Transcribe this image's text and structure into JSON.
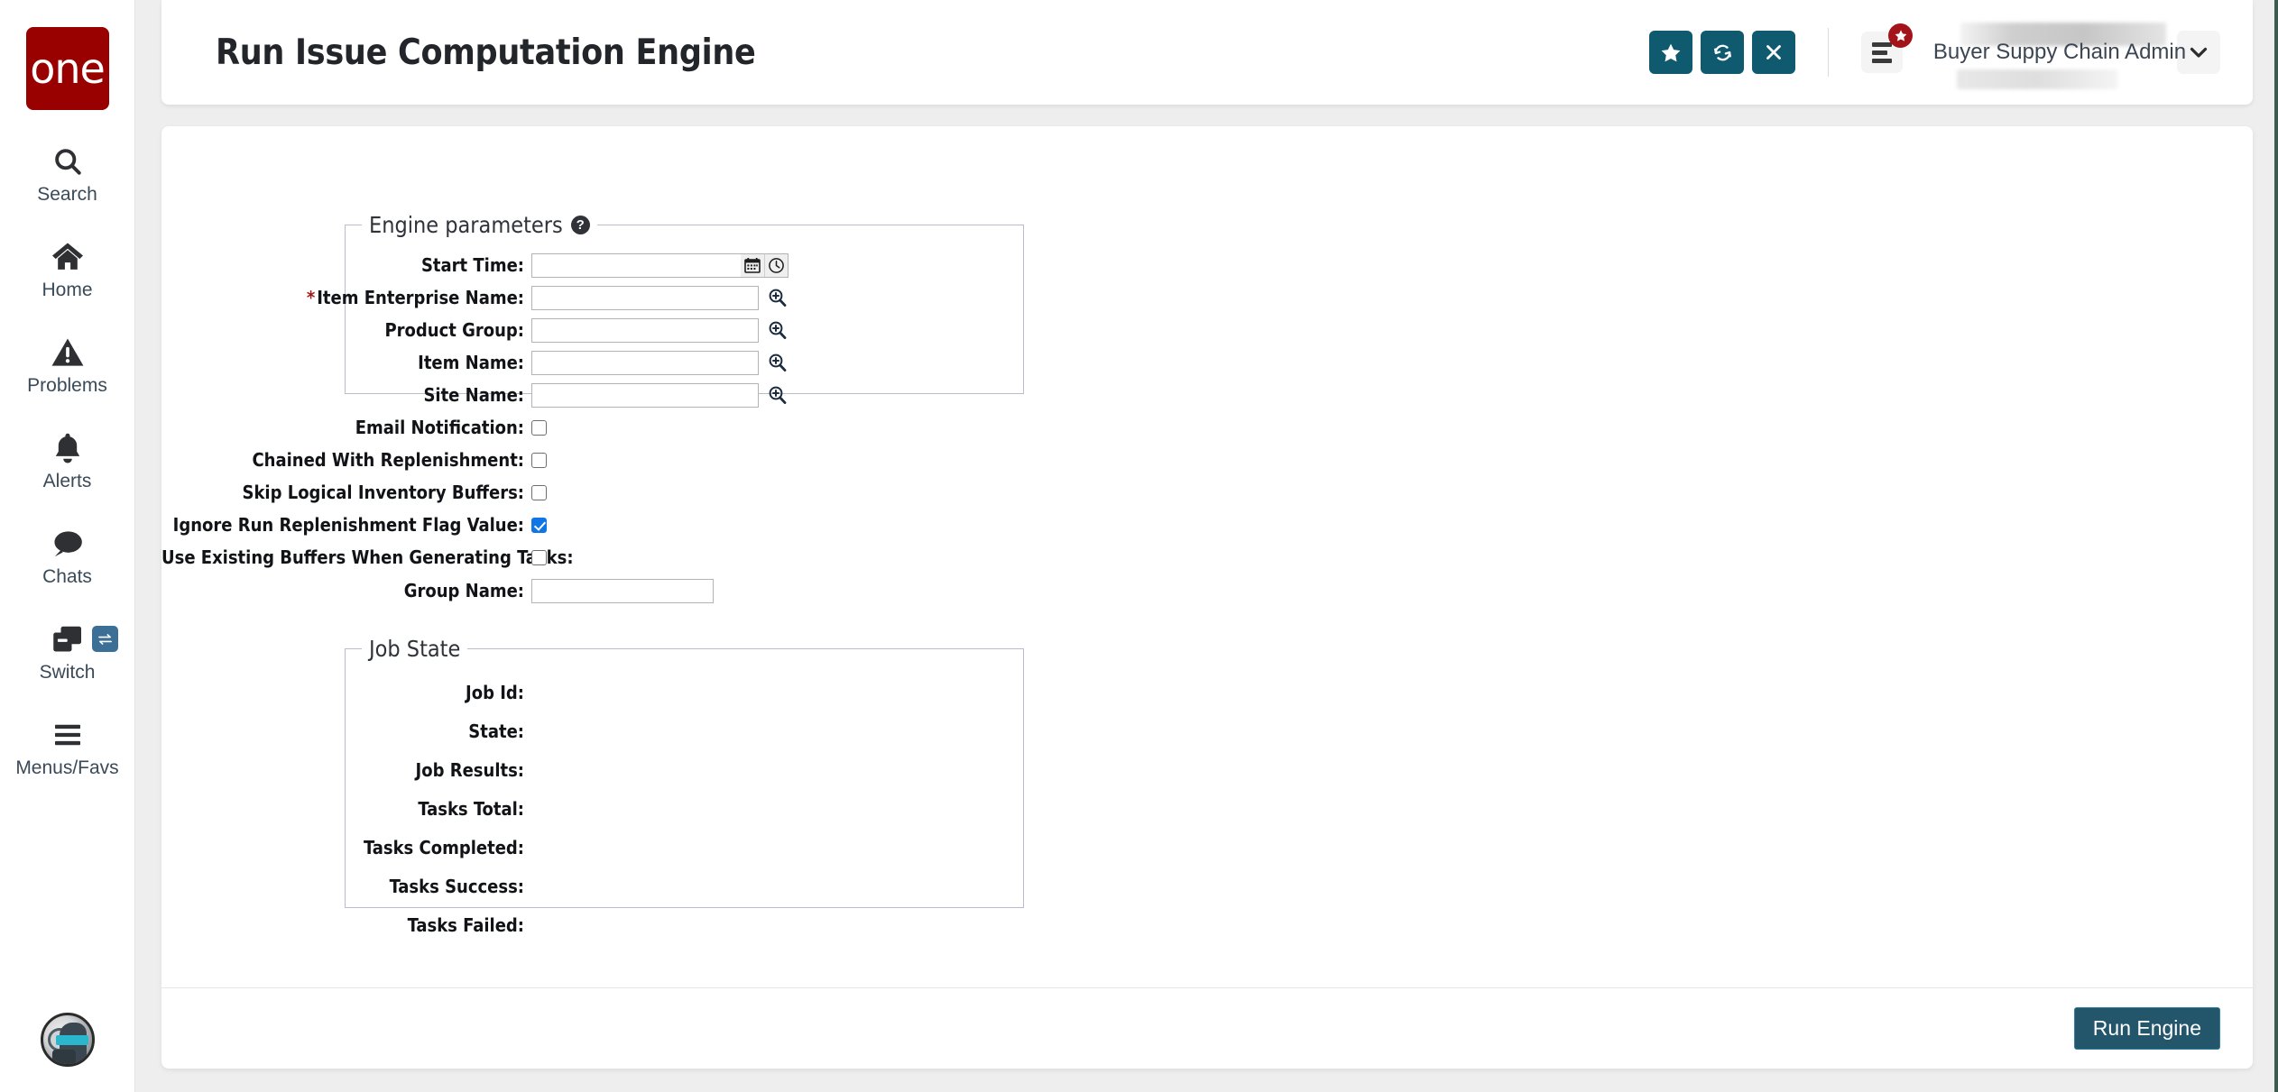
{
  "brand": {
    "logo_text": "one",
    "logo_color": "#990000"
  },
  "sidebar": {
    "items": [
      {
        "label": "Search",
        "icon": "search-icon"
      },
      {
        "label": "Home",
        "icon": "home-icon"
      },
      {
        "label": "Problems",
        "icon": "warning-triangle-icon"
      },
      {
        "label": "Alerts",
        "icon": "bell-icon"
      },
      {
        "label": "Chats",
        "icon": "chat-bubble-icon"
      },
      {
        "label": "Switch",
        "icon": "windows-stack-icon",
        "badge_icon": "swap-arrows-icon"
      },
      {
        "label": "Menus/Favs",
        "icon": "hamburger-icon"
      }
    ],
    "avatar_alt": "robot-avatar"
  },
  "header": {
    "title": "Run Issue Computation Engine",
    "buttons": [
      {
        "name": "favorite-button",
        "icon": "star-icon",
        "glyph": "★"
      },
      {
        "name": "refresh-button",
        "icon": "refresh-icon",
        "glyph": "↻"
      },
      {
        "name": "close-button",
        "icon": "close-icon",
        "glyph": "✕"
      }
    ],
    "button_color": "#0f5a6e",
    "menu_fav_icon": "menu-list-icon",
    "fav_badge_icon": "star-icon",
    "fav_badge_glyph": "★",
    "fav_badge_color": "#a4131a",
    "user_name": "Buyer Suppy Chain Admin",
    "user_caret_icon": "chevron-down-icon",
    "user_caret_glyph": "⌄"
  },
  "engine_parameters": {
    "legend": "Engine parameters",
    "help_icon": "help-circle-icon",
    "help_glyph": "?",
    "fields": [
      {
        "label": "Start Time:",
        "type": "datetime",
        "value": "",
        "required": false,
        "icons": [
          "calendar-icon",
          "clock-icon"
        ]
      },
      {
        "label": "Item Enterprise Name:",
        "type": "lookup",
        "value": "",
        "required": true,
        "icons": [
          "magnifier-plus-icon"
        ]
      },
      {
        "label": "Product Group:",
        "type": "lookup",
        "value": "",
        "required": false,
        "icons": [
          "magnifier-plus-icon"
        ]
      },
      {
        "label": "Item Name:",
        "type": "lookup",
        "value": "",
        "required": false,
        "icons": [
          "magnifier-plus-icon"
        ]
      },
      {
        "label": "Site Name:",
        "type": "lookup",
        "value": "",
        "required": false,
        "icons": [
          "magnifier-plus-icon"
        ]
      },
      {
        "label": "Email Notification:",
        "type": "checkbox",
        "checked": false
      },
      {
        "label": "Chained With Replenishment:",
        "type": "checkbox",
        "checked": false
      },
      {
        "label": "Skip Logical Inventory Buffers:",
        "type": "checkbox",
        "checked": false
      },
      {
        "label": "Ignore Run Replenishment Flag Value:",
        "type": "checkbox",
        "checked": true
      },
      {
        "label": "Use Existing Buffers When Generating Tasks:",
        "type": "checkbox",
        "checked": false
      },
      {
        "label": "Group Name:",
        "type": "text",
        "value": "",
        "required": false
      }
    ]
  },
  "job_state": {
    "legend": "Job State",
    "fields": [
      {
        "label": "Job Id:",
        "value": ""
      },
      {
        "label": "State:",
        "value": ""
      },
      {
        "label": "Job Results:",
        "value": ""
      },
      {
        "label": "Tasks Total:",
        "value": ""
      },
      {
        "label": "Tasks Completed:",
        "value": ""
      },
      {
        "label": "Tasks Success:",
        "value": ""
      },
      {
        "label": "Tasks Failed:",
        "value": ""
      }
    ]
  },
  "footer": {
    "run_label": "Run Engine",
    "run_color": "#23556b"
  }
}
